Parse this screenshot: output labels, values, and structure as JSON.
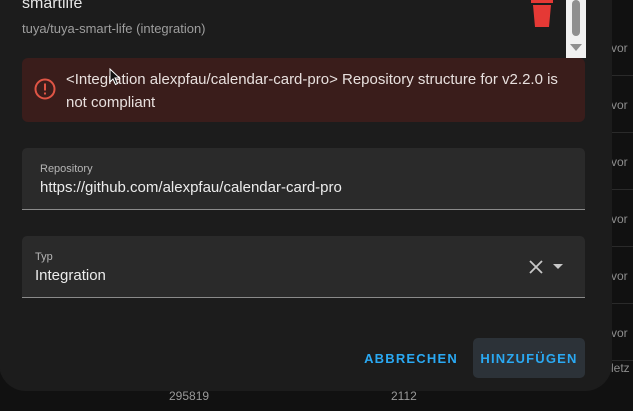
{
  "background": {
    "right_column_labels": [
      "vor",
      "vor",
      "vor",
      "vor",
      "vor",
      "vor",
      "letz"
    ],
    "bottom_values": [
      "295819",
      "2112"
    ]
  },
  "dialog": {
    "item_title": "smartlife",
    "item_subtitle": "tuya/tuya-smart-life (integration)",
    "delete_icon": "trash-icon",
    "alert": {
      "icon": "error-circle-icon",
      "message": "<Integration alexpfau/calendar-card-pro> Repository structure for v2.2.0 is not compliant",
      "color": "#e05545"
    },
    "repository_field": {
      "label": "Repository",
      "value": "https://github.com/alexpfau/calendar-card-pro"
    },
    "type_field": {
      "label": "Typ",
      "value": "Integration"
    },
    "buttons": {
      "cancel": "ABBRECHEN",
      "add": "HINZUFÜGEN"
    },
    "accent_color": "#2aa9f3",
    "delete_color": "#e53935"
  }
}
